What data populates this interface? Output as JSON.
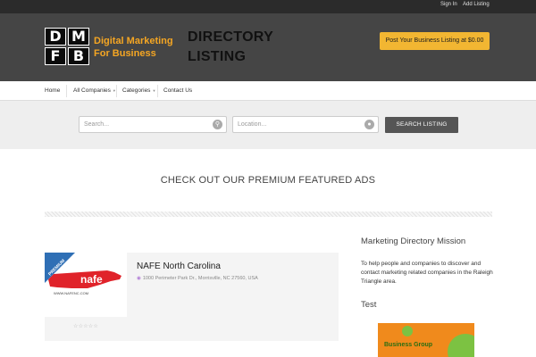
{
  "topbar": {
    "sign_in": "Sign In",
    "add_listing": "Add Listing"
  },
  "header": {
    "logo_letters": [
      "D",
      "M",
      "F",
      "B"
    ],
    "logo_tagline": "Digital Marketing For Business",
    "directory_title": "DIRECTORY LISTING",
    "post_button": "Post Your Business Listing at $0.00"
  },
  "nav": {
    "items": [
      {
        "label": "Home",
        "has_dropdown": false
      },
      {
        "label": "All Companies",
        "has_dropdown": true
      },
      {
        "label": "Categories",
        "has_dropdown": true
      },
      {
        "label": "Contact Us",
        "has_dropdown": false
      }
    ]
  },
  "search": {
    "keyword_placeholder": "Search...",
    "location_placeholder": "Location...",
    "button": "SEARCH LISTING"
  },
  "featured": {
    "title": "CHECK OUT OUR PREMIUM FEATURED ADS"
  },
  "listing": {
    "badge": "PREMIUM",
    "logo_text": "nafe",
    "logo_url_text": "WWW.NAFENC.COM",
    "title": "NAFE North Carolina",
    "address": "1000 Perimeter Park Dr., Morrisville, NC 27560, USA",
    "rating": 0,
    "max_rating": 5
  },
  "sidebar": {
    "mission_title": "Marketing Directory Mission",
    "mission_text": "To help people and companies to discover and contact marketing related companies in the Raleigh Triangle area.",
    "test_title": "Test",
    "ad_text": "Business Group"
  },
  "colors": {
    "topbar": "#2b2b2b",
    "header": "#454545",
    "accent_orange": "#f5a623",
    "post_button": "#f2b632",
    "search_band": "#eeeeee",
    "search_button": "#555555",
    "premium_ribbon": "#2f6fb5",
    "nc_map": "#e0232a",
    "ad_orange": "#f08a1c",
    "ad_green": "#7cc242"
  },
  "icons": {
    "search": "magnifier-icon",
    "location": "location-pin-icon",
    "address_pin": "map-pin-icon",
    "dropdown": "chevron-down-icon",
    "star": "star-icon"
  }
}
